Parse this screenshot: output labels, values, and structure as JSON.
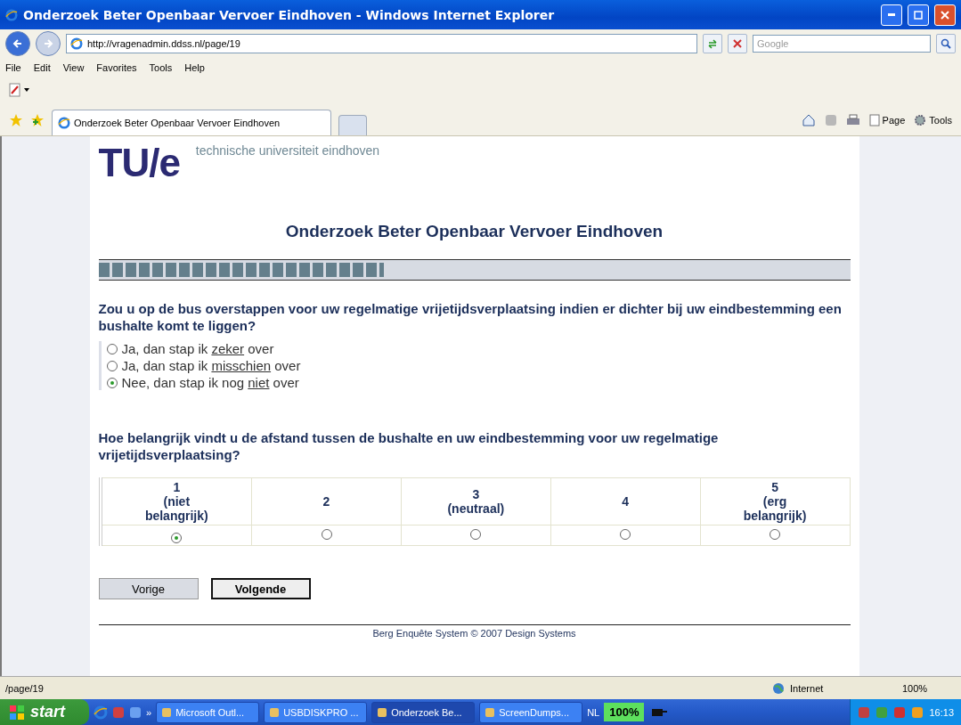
{
  "window": {
    "title": "Onderzoek Beter Openbaar Vervoer Eindhoven - Windows Internet Explorer"
  },
  "address_bar": {
    "url": "http://vragenadmin.ddss.nl/page/19",
    "search_placeholder": "Google"
  },
  "menu": [
    "File",
    "Edit",
    "View",
    "Favorites",
    "Tools",
    "Help"
  ],
  "tabs": [
    {
      "label": "Onderzoek Beter Openbaar Vervoer Eindhoven",
      "selected": true
    }
  ],
  "command_bar": [
    "Page",
    "Tools"
  ],
  "page": {
    "logo": "TU/e",
    "university": "technische universiteit eindhoven",
    "heading": "Onderzoek Beter Openbaar Vervoer Eindhoven",
    "progress": {
      "level": 0.38
    },
    "question_1": {
      "text": "Zou u op de bus overstappen voor uw regelmatige vrijetijdsverplaatsing indien er dichter bij uw eindbestemming een bushalte komt te liggen?",
      "options": [
        {
          "before": "Ja, dan stap ik ",
          "underlined": "zeker",
          "after": " over",
          "selected": false
        },
        {
          "before": "Ja, dan stap ik ",
          "underlined": "misschien",
          "after": " over",
          "selected": false
        },
        {
          "before": "Nee, dan stap ik nog ",
          "underlined": "niet",
          "after": " over",
          "selected": true
        }
      ]
    },
    "question_2": {
      "text": "Hoe belangrijk vindt u de afstand tussen de bushalte en uw eindbestemming voor uw regelmatige vrijetijdsverplaatsing?",
      "scale": [
        {
          "label": "1\n(niet\nbelangrijk)",
          "selected": true
        },
        {
          "label": "2",
          "selected": false
        },
        {
          "label": "3\n(neutraal)",
          "selected": false
        },
        {
          "label": "4",
          "selected": false
        },
        {
          "label": "5\n(erg\nbelangrijk)",
          "selected": false
        }
      ]
    },
    "buttons": [
      {
        "label": "Vorige",
        "kind": "secondary"
      },
      {
        "label": "Volgende",
        "kind": "primary"
      }
    ],
    "footer": "Berg Enquête System © 2007 Design Systems"
  },
  "status_bar": {
    "url": "/page/19",
    "zone": "Internet",
    "zoom": "100%"
  },
  "taskbar": {
    "start": "start",
    "more": "»",
    "tasks": [
      {
        "label": "Microsoft Outl...",
        "selected": false
      },
      {
        "label": "USBDISKPRO ...",
        "selected": false
      },
      {
        "label": "Onderzoek Be...",
        "selected": true
      },
      {
        "label": "ScreenDumps...",
        "selected": false
      }
    ],
    "language": "NL",
    "battery": "100%",
    "clock": "16:13"
  }
}
